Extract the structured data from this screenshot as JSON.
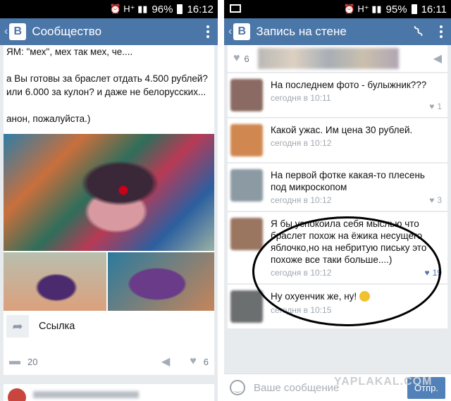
{
  "left": {
    "status": {
      "icons": "⏰ H⁺ ▮▮",
      "battery": "96%",
      "time": "16:12"
    },
    "appbar": {
      "title": "Сообщество"
    },
    "post": {
      "text": "ЯМ: \"мех\", мех так мех, че....\n\nа Вы готовы за браслет отдать 4.500 рублей? или 6.000 за кулон? и даже не белорусских...\n\nанон, пожалуйста.)",
      "link_label": "Ссылка",
      "comments_count": "20",
      "likes_count": "6"
    }
  },
  "right": {
    "status": {
      "icons": "⏰ H⁺ ▮▮",
      "battery": "95%",
      "time": "16:11"
    },
    "appbar": {
      "title": "Запись на стене"
    },
    "likebar": {
      "likes": "6"
    },
    "comments": [
      {
        "text": "На последнем фото - булыжник???",
        "time": "сегодня в 10:11",
        "likes": "1",
        "liked": false,
        "avatar": "#8a6a62"
      },
      {
        "text": "Какой ужас. Им цена 30 рублей.",
        "time": "сегодня в 10:12",
        "likes": "",
        "liked": false,
        "avatar": "#d08850"
      },
      {
        "text": "На первой фотке какая-то плесень под микроскопом",
        "time": "сегодня в 10:12",
        "likes": "3",
        "liked": false,
        "avatar": "#8c9aa4"
      },
      {
        "text": "Я бы успокоила себя мыслью что браслет похож на ёжика несущего яблочко,но на небритую письку это похоже все таки больше....)",
        "time": "сегодня в 10:12",
        "likes": "19",
        "liked": true,
        "avatar": "#9a7560"
      },
      {
        "text": "Ну охуенчик же, ну!",
        "time": "сегодня в 10:15",
        "likes": "",
        "liked": false,
        "avatar": "#6c6f70"
      }
    ],
    "input": {
      "placeholder": "Ваше сообщение",
      "send_label": "Отпр."
    },
    "watermark": "YAPLAKAL.COM"
  }
}
